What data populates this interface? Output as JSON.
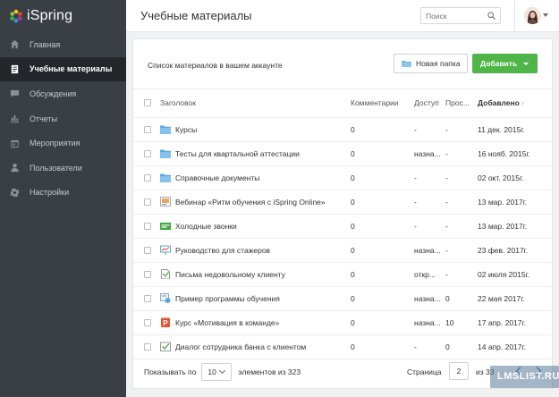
{
  "app": {
    "logo_text": "iSpring"
  },
  "sidebar": {
    "items": [
      {
        "label": "Главная",
        "icon": "home-icon",
        "active": false
      },
      {
        "label": "Учебные материалы",
        "icon": "book-icon",
        "active": true
      },
      {
        "label": "Обсуждения",
        "icon": "chat-icon",
        "active": false
      },
      {
        "label": "Отчеты",
        "icon": "chart-icon",
        "active": false
      },
      {
        "label": "Мероприятия",
        "icon": "calendar-icon",
        "active": false
      },
      {
        "label": "Пользователи",
        "icon": "user-icon",
        "active": false
      },
      {
        "label": "Настройки",
        "icon": "gear-icon",
        "active": false
      }
    ]
  },
  "header": {
    "title": "Учебные материалы",
    "search_placeholder": "Поиск"
  },
  "toolbar": {
    "subtitle": "Список материалов в вашем аккаунте",
    "new_folder_label": "Новая папка",
    "add_label": "Добавить"
  },
  "table": {
    "columns": [
      "Заголовок",
      "Комментарии",
      "Доступ",
      "Прос...",
      "Добавлено"
    ],
    "sort_indicator": "↑",
    "rows": [
      {
        "icon": "folder-icon",
        "title": "Курсы",
        "comments": "0",
        "access": "-",
        "views": "-",
        "added": "11 дек. 2015г."
      },
      {
        "icon": "folder-icon",
        "title": "Тесты для квартальной аттестации",
        "comments": "0",
        "access": "назна...",
        "views": "-",
        "added": "16 нояб. 2015г."
      },
      {
        "icon": "folder-icon",
        "title": "Справочные документы",
        "comments": "0",
        "access": "-",
        "views": "-",
        "added": "02 окт. 2015г."
      },
      {
        "icon": "webinar-icon",
        "title": "Вебинар «Ритм обучения с iSpring Online»",
        "comments": "0",
        "access": "-",
        "views": "-",
        "added": "13 мар. 2017г."
      },
      {
        "icon": "video-icon",
        "title": "Холодные звонки",
        "comments": "0",
        "access": "-",
        "views": "-",
        "added": "13 мар. 2017г."
      },
      {
        "icon": "presentation-icon",
        "title": "Руководство для стажеров",
        "comments": "0",
        "access": "назна...",
        "views": "-",
        "added": "23 фев. 2017г."
      },
      {
        "icon": "document-icon",
        "title": "Письма недовольному клиенту",
        "comments": "0",
        "access": "откр...",
        "views": "-",
        "added": "02 июля 2015г."
      },
      {
        "icon": "course-icon",
        "title": "Пример программы обучения",
        "comments": "0",
        "access": "назна...",
        "views": "0",
        "added": "22 мая 2017г."
      },
      {
        "icon": "powerpoint-icon",
        "title": "Курс «Мотивация в команде»",
        "comments": "0",
        "access": "назна...",
        "views": "10",
        "added": "17 апр. 2017г."
      },
      {
        "icon": "dialog-icon",
        "title": "Диалог сотрудника банка с клиентом",
        "comments": "0",
        "access": "-",
        "views": "0",
        "added": "14 апр. 2017г."
      }
    ]
  },
  "footer": {
    "per_page_label": "Показывать по",
    "per_page_value": "10",
    "total_label": "элементов из 323",
    "page_label": "Страница",
    "page_value": "2",
    "page_of": "из 33"
  },
  "watermark": {
    "text": "LMSLIST.RU"
  },
  "colors": {
    "sidebar": "#3a3f45",
    "sidebar_active": "#23272b",
    "accent_green": "#4fb548",
    "folder_blue": "#5aa9de"
  }
}
